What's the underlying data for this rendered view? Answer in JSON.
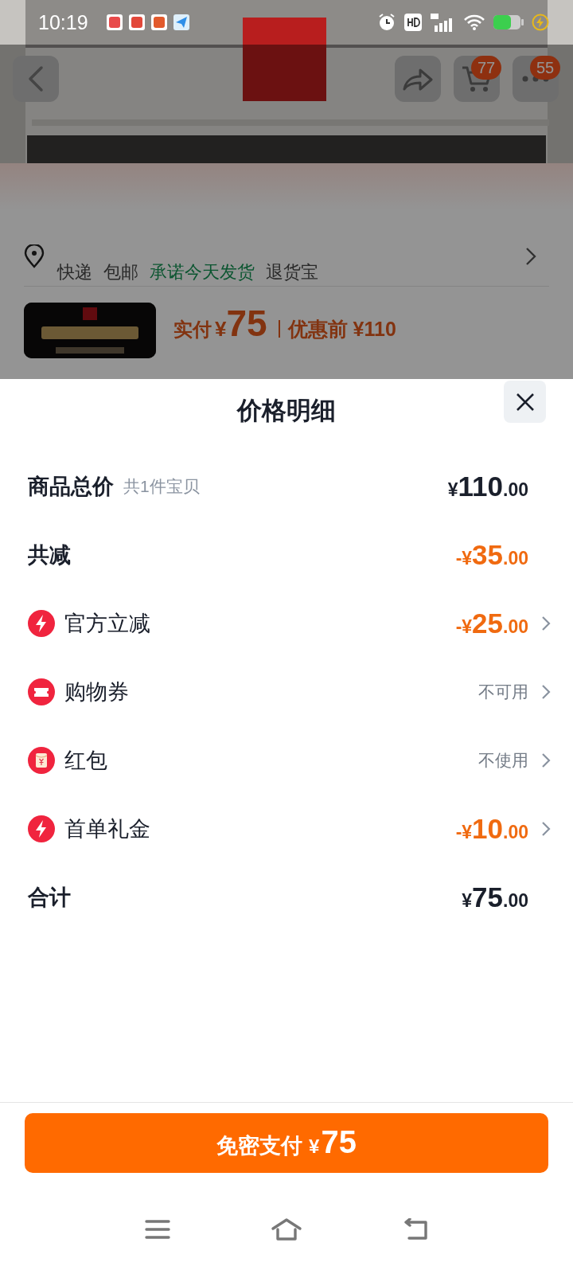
{
  "status_bar": {
    "time": "10:19"
  },
  "product_page": {
    "top_bar": [
      {
        "kind": "back"
      },
      {
        "kind": "share"
      },
      {
        "kind": "cart",
        "badge": "77"
      },
      {
        "kind": "more",
        "badge": "55"
      }
    ],
    "delivery": [
      {
        "text": "快递",
        "color": "#2a2a2a"
      },
      {
        "text": "包邮",
        "color": "#2a2a2a"
      },
      {
        "text": "承诺今天发货",
        "color": "#0b5530"
      },
      {
        "text": "退货宝",
        "color": "#2a2a2a"
      }
    ],
    "product": {
      "price_label": "实付",
      "currency": "¥",
      "price": "75",
      "original_price": "优惠前 ¥110"
    }
  },
  "price_sheet": {
    "title": "价格明细",
    "rows": [
      {
        "kind": "header",
        "label": "商品总价",
        "note": "共1件宝贝",
        "amount": {
          "prefix": "¥",
          "integer": "110",
          "decimals": ".00"
        }
      },
      {
        "kind": "reduction",
        "label": "共减",
        "amount": {
          "prefix": "-¥",
          "integer": "35",
          "decimals": ".00"
        }
      },
      {
        "kind": "lightning",
        "label": "官方立减",
        "amount": {
          "prefix": "-¥",
          "integer": "25",
          "decimals": ".00"
        }
      },
      {
        "kind": "coupon",
        "label": "购物券",
        "status": "不可用"
      },
      {
        "kind": "envelope",
        "label": "红包",
        "status": "不使用"
      },
      {
        "kind": "lightning",
        "label": "首单礼金",
        "amount": {
          "prefix": "-¥",
          "integer": "10",
          "decimals": ".00"
        }
      },
      {
        "kind": "total",
        "label": "合计",
        "amount": {
          "prefix": "¥",
          "integer": "75",
          "decimals": ".00"
        }
      }
    ],
    "pay_button": {
      "label": "免密支付",
      "currency": "¥",
      "amount": "75"
    }
  }
}
